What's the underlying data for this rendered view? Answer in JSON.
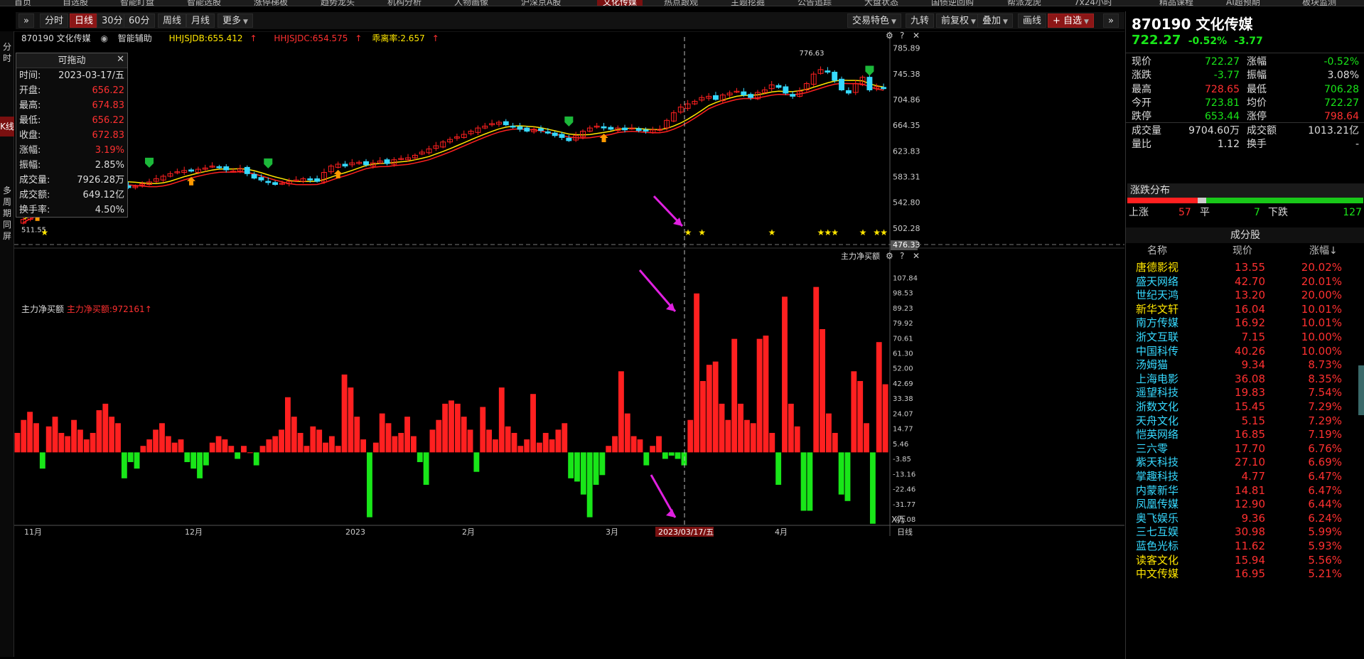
{
  "top_nav": {
    "tabs": [
      "首页",
      "自选股",
      "智能盯盘",
      "智能选股",
      "涨停梯板",
      "趋势龙头",
      "机构分析",
      "人物画像",
      "沪深京A股",
      "文化传媒",
      "热点跟观",
      "主题挖掘",
      "公告追踪",
      "大盘状态",
      "国债逆回购",
      "帮派龙虎",
      "7x24小时",
      "精品课程",
      "AI超预期",
      "板块监测"
    ],
    "active_tab": "文化传媒"
  },
  "toolbar": {
    "left_buttons": [
      "分时",
      "日线",
      "30分",
      "60分",
      "周线",
      "月线",
      "更多"
    ],
    "active_period": "日线",
    "right_buttons": [
      "交易特色",
      "九转",
      "前复权",
      "叠加",
      "画线",
      "自选"
    ]
  },
  "left_strip": {
    "tabs": [
      "分时",
      "K线",
      "多周期同屏"
    ],
    "active": "K线"
  },
  "chart_header": {
    "stock": "870190 文化传媒",
    "assist": "智能辅助",
    "ind1": "HHJSJDB:655.412",
    "ind2": "HHJSJDC:654.575",
    "ind3": "乖离率:2.657"
  },
  "float_box": {
    "title": "可拖动",
    "rows": [
      {
        "k": "时间:",
        "v": "2023-03-17/五"
      },
      {
        "k": "开盘:",
        "v": "656.22"
      },
      {
        "k": "最高:",
        "v": "674.83"
      },
      {
        "k": "最低:",
        "v": "656.22"
      },
      {
        "k": "收盘:",
        "v": "672.83"
      },
      {
        "k": "涨幅:",
        "v": "3.19%"
      },
      {
        "k": "振幅:",
        "v": "2.85%"
      },
      {
        "k": "成交量:",
        "v": "7926.28万"
      },
      {
        "k": "成交额:",
        "v": "649.12亿"
      },
      {
        "k": "换手率:",
        "v": "4.50%"
      }
    ]
  },
  "lower_header": {
    "name": "主力净买额",
    "value": "主力净买额:972161",
    "right_label": "主力净买额"
  },
  "chart_data": [
    {
      "type": "candlestick",
      "title": "",
      "ylim": [
        476.33,
        790
      ],
      "y_ticks": [
        "785.89",
        "745.38",
        "704.86",
        "664.35",
        "623.83",
        "583.31",
        "542.80",
        "502.28",
        "476.33"
      ],
      "high_annotation": "776.63",
      "low_annotation": "511.55",
      "x_labels": [
        "11月",
        "12月",
        "2023",
        "2月",
        "3月",
        "2023/03/17/五",
        "4月"
      ],
      "period_label": "日线",
      "closes": [
        516,
        528,
        536,
        544,
        551,
        556,
        560,
        565,
        570,
        574,
        578,
        582,
        580,
        576,
        571,
        566,
        568,
        572,
        575,
        580,
        584,
        588,
        591,
        593,
        592,
        595,
        597,
        600,
        598,
        594,
        592,
        596,
        588,
        581,
        578,
        574,
        571,
        573,
        576,
        578,
        580,
        578,
        576,
        590,
        600,
        603,
        600,
        605,
        606,
        602,
        605,
        608,
        604,
        610,
        612,
        613,
        617,
        622,
        627,
        632,
        638,
        642,
        646,
        650,
        655,
        660,
        663,
        667,
        669,
        665,
        662,
        658,
        655,
        658,
        656,
        652,
        648,
        645,
        640,
        648,
        655,
        660,
        663,
        660,
        658,
        660,
        657,
        660,
        656,
        655,
        657,
        658,
        672,
        684,
        693,
        698,
        702,
        708,
        710,
        705,
        712,
        715,
        718,
        712,
        708,
        716,
        720,
        728,
        724,
        715,
        710,
        718,
        730,
        745,
        752,
        748,
        735,
        720,
        715,
        730,
        740,
        720,
        725,
        722
      ],
      "ma_yellow_start": 520,
      "ma_yellow_end": 727,
      "ma_red_start": 515,
      "ma_red_end": 722
    },
    {
      "type": "bar",
      "title": "主力净买额",
      "unit": "X万",
      "ylim": [
        -45,
        115
      ],
      "y_ticks": [
        "107.84",
        "98.53",
        "89.23",
        "79.92",
        "70.61",
        "61.30",
        "52.00",
        "42.69",
        "33.38",
        "24.07",
        "14.77",
        "5.46",
        "-3.85",
        "-13.16",
        "-22.46",
        "-31.77",
        "-41.08"
      ],
      "values": [
        12,
        20,
        25,
        18,
        -10,
        16,
        22,
        12,
        10,
        20,
        14,
        8,
        12,
        26,
        30,
        22,
        18,
        -16,
        -6,
        -10,
        4,
        8,
        14,
        18,
        10,
        6,
        8,
        -6,
        -10,
        -16,
        -8,
        6,
        10,
        8,
        4,
        -4,
        4,
        0,
        -8,
        4,
        8,
        10,
        14,
        34,
        22,
        12,
        4,
        16,
        14,
        6,
        10,
        4,
        48,
        40,
        22,
        8,
        -40,
        6,
        24,
        18,
        10,
        12,
        22,
        10,
        -6,
        -20,
        14,
        20,
        30,
        32,
        30,
        22,
        14,
        -12,
        28,
        14,
        8,
        40,
        16,
        12,
        4,
        8,
        36,
        6,
        12,
        8,
        14,
        18,
        -16,
        -18,
        -26,
        -40,
        -20,
        -14,
        4,
        10,
        50,
        24,
        10,
        8,
        -8,
        4,
        10,
        -4,
        -2,
        -4,
        -8,
        20,
        98,
        44,
        54,
        56,
        30,
        20,
        70,
        30,
        20,
        18,
        70,
        72,
        12,
        -20,
        96,
        30,
        16,
        -36,
        -36,
        102,
        76,
        24,
        12,
        -26,
        -30,
        50,
        44,
        18,
        -44,
        68,
        42
      ]
    }
  ],
  "right_panel": {
    "title": "870190 文化传媒",
    "price": "722.27",
    "change_pct": "-0.52%",
    "change": "-3.77",
    "quote_rows": [
      {
        "lk": "现价",
        "lv": "722.27",
        "lc": "#19e619",
        "rk": "涨幅",
        "rv": "-0.52%",
        "rc": "#19e619"
      },
      {
        "lk": "涨跌",
        "lv": "-3.77",
        "lc": "#19e619",
        "rk": "振幅",
        "rv": "3.08%",
        "rc": "#dddddd"
      },
      {
        "lk": "最高",
        "lv": "728.65",
        "lc": "#ff3030",
        "rk": "最低",
        "rv": "706.28",
        "rc": "#19e619"
      },
      {
        "lk": "今开",
        "lv": "723.81",
        "lc": "#19e619",
        "rk": "均价",
        "rv": "722.27",
        "rc": "#19e619"
      },
      {
        "lk": "跌停",
        "lv": "653.44",
        "lc": "#19e619",
        "rk": "涨停",
        "rv": "798.64",
        "rc": "#ff3030"
      },
      {
        "lk": "成交量",
        "lv": "9704.60万",
        "lc": "#dddddd",
        "rk": "成交额",
        "rv": "1013.21亿",
        "rc": "#dddddd"
      },
      {
        "lk": "量比",
        "lv": "1.12",
        "lc": "#dddddd",
        "rk": "换手",
        "rv": "-",
        "rc": "#dddddd"
      }
    ],
    "dist_title": "涨跌分布",
    "dist": {
      "up_label": "上涨",
      "up": 57,
      "flat_label": "平",
      "flat": 7,
      "down_label": "下跌",
      "down": 127
    },
    "components_title": "成分股",
    "components_headers": [
      "名称",
      "现价",
      "涨幅↓"
    ],
    "components": [
      {
        "name": "唐德影视",
        "price": "13.55",
        "change": "20.02%",
        "color": "#ffe600"
      },
      {
        "name": "盛天网络",
        "price": "42.70",
        "change": "20.01%",
        "color": "#36d9ff"
      },
      {
        "name": "世纪天鸿",
        "price": "13.20",
        "change": "20.00%",
        "color": "#36d9ff"
      },
      {
        "name": "新华文轩",
        "price": "16.04",
        "change": "10.01%",
        "color": "#ffe600"
      },
      {
        "name": "南方传媒",
        "price": "16.92",
        "change": "10.01%",
        "color": "#36d9ff"
      },
      {
        "name": "浙文互联",
        "price": "7.15",
        "change": "10.00%",
        "color": "#36d9ff"
      },
      {
        "name": "中国科传",
        "price": "40.26",
        "change": "10.00%",
        "color": "#36d9ff"
      },
      {
        "name": "汤姆猫",
        "price": "9.34",
        "change": "8.73%",
        "color": "#36d9ff"
      },
      {
        "name": "上海电影",
        "price": "36.08",
        "change": "8.35%",
        "color": "#36d9ff"
      },
      {
        "name": "遥望科技",
        "price": "19.83",
        "change": "7.54%",
        "color": "#36d9ff"
      },
      {
        "name": "浙数文化",
        "price": "15.45",
        "change": "7.29%",
        "color": "#36d9ff"
      },
      {
        "name": "天舟文化",
        "price": "5.15",
        "change": "7.29%",
        "color": "#36d9ff"
      },
      {
        "name": "恺英网络",
        "price": "16.85",
        "change": "7.19%",
        "color": "#36d9ff"
      },
      {
        "name": "三六零",
        "price": "17.70",
        "change": "6.76%",
        "color": "#36d9ff"
      },
      {
        "name": "紫天科技",
        "price": "27.10",
        "change": "6.69%",
        "color": "#36d9ff"
      },
      {
        "name": "掌趣科技",
        "price": "4.77",
        "change": "6.47%",
        "color": "#36d9ff"
      },
      {
        "name": "内蒙新华",
        "price": "14.81",
        "change": "6.47%",
        "color": "#36d9ff"
      },
      {
        "name": "凤凰传媒",
        "price": "12.90",
        "change": "6.44%",
        "color": "#36d9ff"
      },
      {
        "name": "奥飞娱乐",
        "price": "9.36",
        "change": "6.24%",
        "color": "#36d9ff"
      },
      {
        "name": "三七互娱",
        "price": "30.98",
        "change": "5.99%",
        "color": "#36d9ff"
      },
      {
        "name": "蓝色光标",
        "price": "11.62",
        "change": "5.93%",
        "color": "#36d9ff"
      },
      {
        "name": "读客文化",
        "price": "15.94",
        "change": "5.56%",
        "color": "#ffe600"
      },
      {
        "name": "中文传媒",
        "price": "16.95",
        "change": "5.21%",
        "color": "#ffe600"
      }
    ]
  },
  "colors": {
    "up": "#ff2020",
    "down": "#19e619",
    "doji_up": "#36d9ff",
    "ma_yellow": "#ffe600",
    "ma_red": "#ff2020",
    "annotation_arrow": "#e020e0"
  }
}
